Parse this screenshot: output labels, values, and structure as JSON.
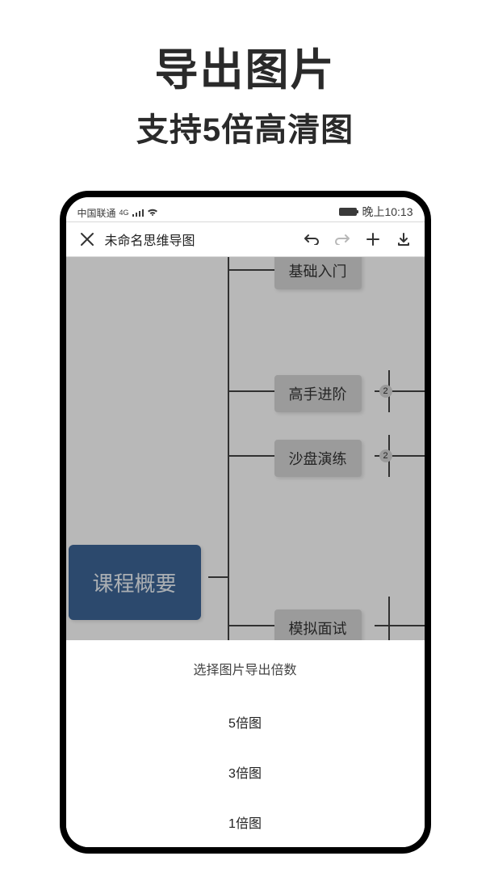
{
  "marketing": {
    "title": "导出图片",
    "subtitle": "支持5倍高清图"
  },
  "status_bar": {
    "carrier": "中国联通",
    "network_badge": "4G",
    "time": "晚上10:13"
  },
  "toolbar": {
    "document_title": "未命名思维导图"
  },
  "mindmap": {
    "root": {
      "label": "课程概要"
    },
    "nodes": [
      {
        "id": "n1",
        "label": "基础入门",
        "badge": null
      },
      {
        "id": "n2",
        "label": "高手进阶",
        "badge": "2"
      },
      {
        "id": "n3",
        "label": "沙盘演练",
        "badge": "2"
      },
      {
        "id": "n4",
        "label": "模拟面试",
        "badge": null
      }
    ]
  },
  "export_sheet": {
    "title": "选择图片导出倍数",
    "options": [
      {
        "label": "5倍图"
      },
      {
        "label": "3倍图"
      },
      {
        "label": "1倍图"
      }
    ]
  }
}
